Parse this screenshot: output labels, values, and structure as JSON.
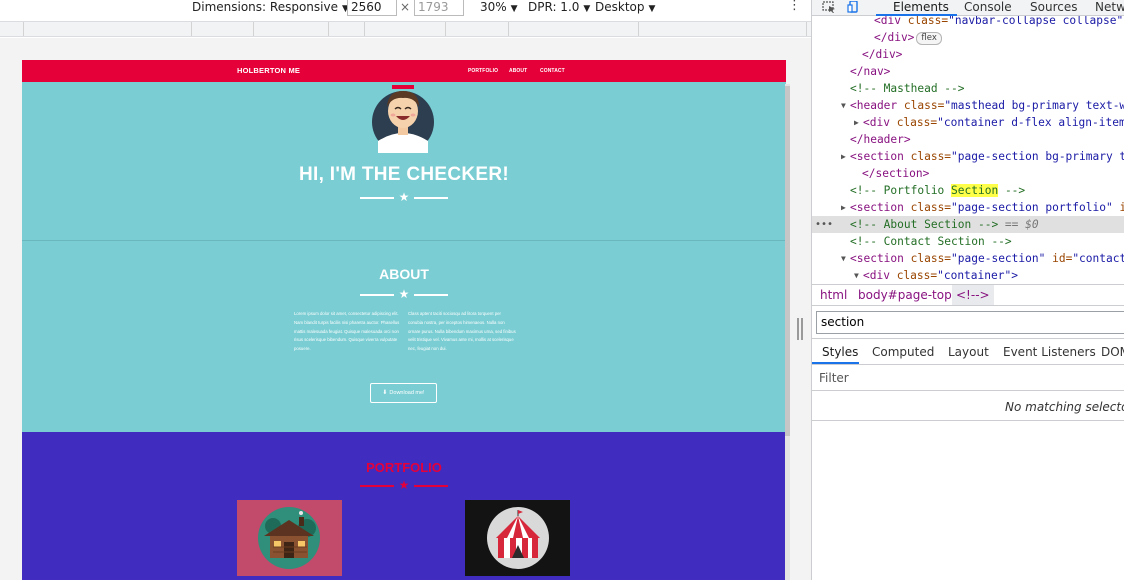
{
  "device_toolbar": {
    "dimensions_label": "Dimensions: Responsive",
    "width_value": "2560",
    "times": "×",
    "height_placeholder": "1793",
    "zoom": "30%",
    "dpr": "DPR: 1.0",
    "device_type": "Desktop",
    "menu_glyph": "⋮"
  },
  "page": {
    "brand": "HOLBERTON ME",
    "nav_links": [
      "PORTFOLIO",
      "ABOUT",
      "CONTACT"
    ],
    "hero_title": "HI, I'M THE CHECKER!",
    "about_title": "ABOUT",
    "about_text_left": "Lorem ipsum dolor sit amet, consectetur adipiscing elit. Nam blandit turpis facilis nisi pharetra auctor. Phasellus mattis malesuada feugiat. Quisque malesuada orci non risus scelerisque bibendum. Quisque viverra vulputate posuere.",
    "about_text_right": "Class aptent taciti sociosqu ad litora torquent per conubia nostra, per inceptos himenaeos. Nulla non ornare purus. Nulla bibendum maximus urna, sed finibus velit tristique vel. Vivamus ante mi, mollis at scelerisque nec, feugiat non dui.",
    "download_label": "Download me!",
    "portfolio_title": "PORTFOLIO",
    "colors": {
      "navbar": "#e5003a",
      "masthead": "#79cdd3",
      "portfolio_bg": "#402cbf",
      "accent": "#e5003a"
    }
  },
  "devtools": {
    "tabs": [
      "Elements",
      "Console",
      "Sources",
      "Netwo"
    ],
    "active_tab": "Elements",
    "dom_lines": {
      "l1_tag_open": "<div ",
      "l1_attr": "class=",
      "l1_val": "\"navbar-collapse collapse\"",
      "l2_tag": "</div>",
      "l2_badge": "flex",
      "l3_tag": "</div>",
      "l4_tag": "</nav>",
      "l5_comment": "<!-- Masthead -->",
      "l6_tag_open": "<header ",
      "l6_attr": "class=",
      "l6_val": "\"masthead bg-primary text-wh",
      "l7_tag_open": "<div ",
      "l7_attr": "class=",
      "l7_val": "\"container d-flex align-items",
      "l8_tag": "</header>",
      "l9_tag_open": "<section ",
      "l9_attr": "class=",
      "l9_val": "\"page-section bg-primary te",
      "l10_tag": "</section>",
      "l11_comment_pre": "<!-- Portfolio ",
      "l11_highlight": "Section",
      "l11_comment_post": " -->",
      "l12_tag_open": "<section ",
      "l12_attr": "class=",
      "l12_val": "\"page-section portfolio\" ",
      "l12_attr2": "id",
      "l13_dots": "•••",
      "l13_comment": "<!-- About Section -->",
      "l13_marker": " == $0",
      "l14_comment": "<!-- Contact Section -->",
      "l15_tag_open": "<section ",
      "l15_attr": "class=",
      "l15_val": "\"page-section\" ",
      "l15_attr2": "id=",
      "l15_val2": "\"contact\"",
      "l16_tag_open": "<div ",
      "l16_attr": "class=",
      "l16_val": "\"container\">"
    },
    "breadcrumbs": [
      "html",
      "body#page-top",
      "<!-->"
    ],
    "search_value": "section",
    "styles_tabs": [
      "Styles",
      "Computed",
      "Layout",
      "Event Listeners",
      "DOM"
    ],
    "filter_placeholder": "Filter",
    "no_match_text": "No matching selector o"
  }
}
